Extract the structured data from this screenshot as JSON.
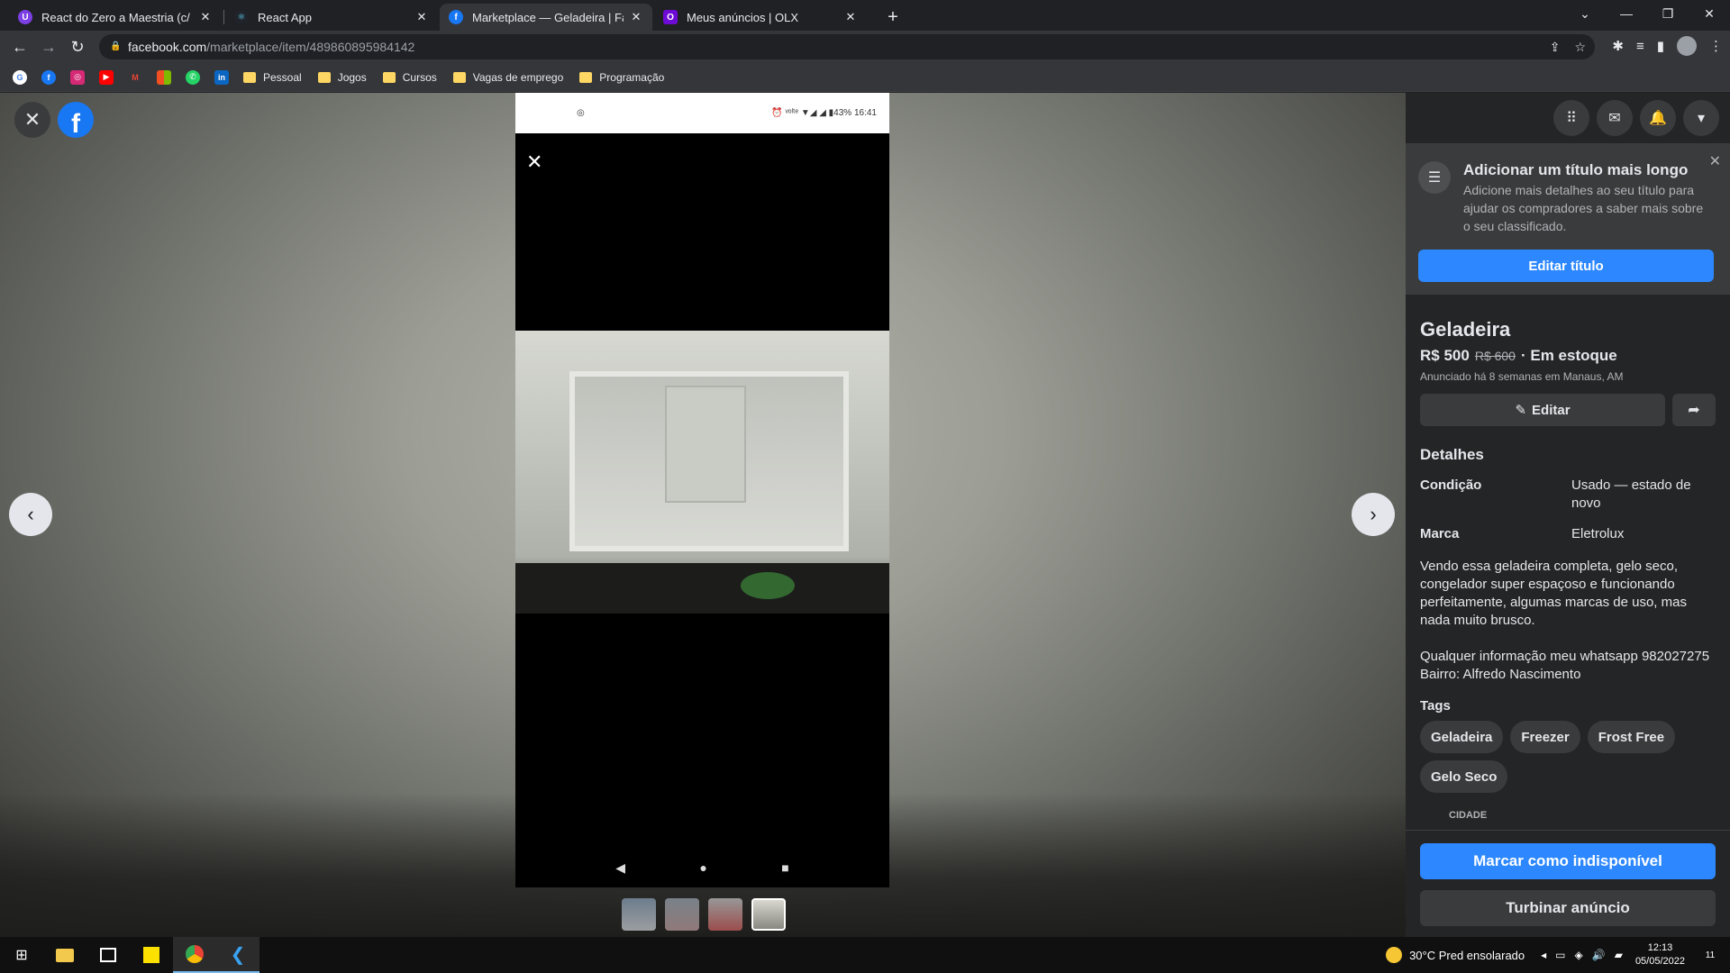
{
  "browser": {
    "tabs": [
      {
        "title": "React do Zero a Maestria (c/ hoo",
        "favicon_color": "#7b3fe4",
        "favicon_letter": "U"
      },
      {
        "title": "React App",
        "favicon_color": "#61dafb",
        "favicon_letter": "⚛"
      },
      {
        "title": "Marketplace — Geladeira | Faceb",
        "favicon_color": "#1877f2",
        "favicon_letter": "f"
      },
      {
        "title": "Meus anúncios | OLX",
        "favicon_color": "#6e0ad6",
        "favicon_letter": "O"
      }
    ],
    "url_domain": "facebook.com",
    "url_path": "/marketplace/item/489860895984142",
    "bookmarks": [
      {
        "label": "Pessoal"
      },
      {
        "label": "Jogos"
      },
      {
        "label": "Cursos"
      },
      {
        "label": "Vagas de emprego"
      },
      {
        "label": "Programação"
      }
    ]
  },
  "viewer": {
    "phone_status_right": "⏰ ᵛᵒˡᵗᵉ ▼◢ ◢ ▮43% 16:41"
  },
  "panel": {
    "tip": {
      "title": "Adicionar um título mais longo",
      "text": "Adicione mais detalhes ao seu título para ajudar os compradores a saber mais sobre o seu classificado.",
      "button": "Editar título"
    },
    "listing": {
      "title": "Geladeira",
      "price": "R$ 500",
      "old_price": "R$ 600",
      "stock": "· Em estoque",
      "posted": "Anunciado há 8 semanas em Manaus, AM",
      "edit_label": "Editar",
      "details_heading": "Detalhes",
      "condition_label": "Condição",
      "condition_value": "Usado — estado de novo",
      "brand_label": "Marca",
      "brand_value": "Eletrolux",
      "description_1": "Vendo essa geladeira completa, gelo seco, congelador super espaçoso e funcionando perfeitamente, algumas marcas de uso, mas nada muito brusco.",
      "description_2": "Qualquer informação meu whatsapp 982027275 Bairro: Alfredo Nascimento",
      "tags_heading": "Tags",
      "tags": [
        "Geladeira",
        "Freezer",
        "Frost Free",
        "Gelo Seco"
      ],
      "map_label": "CIDADE"
    },
    "buttons": {
      "mark_unavailable": "Marcar como indisponível",
      "boost": "Turbinar anúncio"
    }
  },
  "taskbar": {
    "weather": "30°C  Pred ensolarado",
    "time": "12:13",
    "date": "05/05/2022",
    "notif_count": "11"
  },
  "colors": {
    "fb_blue": "#2d88ff",
    "panel_bg": "#242526",
    "card_bg": "#3a3b3c"
  }
}
